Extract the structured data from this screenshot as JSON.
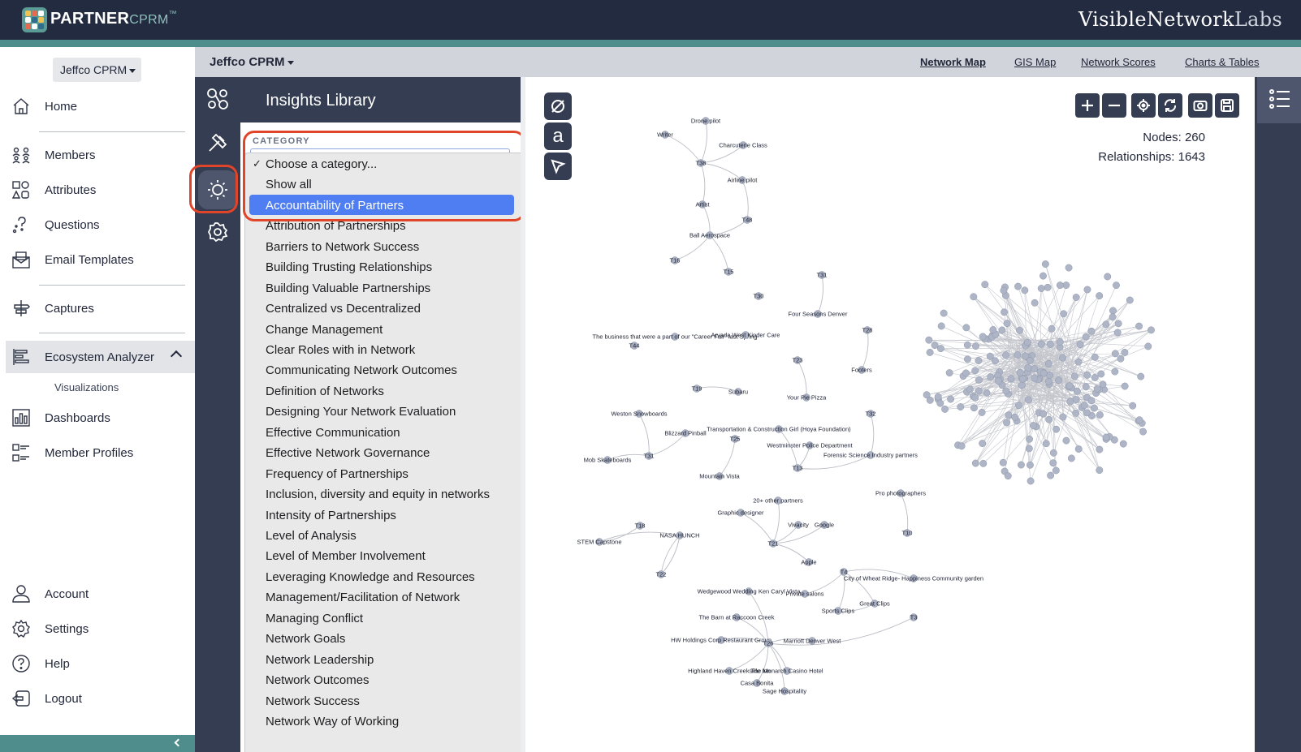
{
  "header": {
    "logo_main": "PARTNER",
    "logo_sub": "CPRM",
    "logo_tm": "™",
    "brand_main": "VisibleNetwork",
    "brand_sub": "Labs"
  },
  "sidebar": {
    "org": "Jeffco CPRM",
    "items": {
      "home": "Home",
      "members": "Members",
      "attributes": "Attributes",
      "questions": "Questions",
      "email_templates": "Email Templates",
      "captures": "Captures",
      "ecosystem": "Ecosystem Analyzer",
      "visualizations": "Visualizations",
      "dashboards": "Dashboards",
      "member_profiles": "Member Profiles",
      "account": "Account",
      "settings": "Settings",
      "help": "Help",
      "logout": "Logout"
    }
  },
  "subheader": {
    "project": "Jeffco CPRM",
    "tabs": [
      "Network Map",
      "GIS Map",
      "Network Scores",
      "Charts & Tables"
    ]
  },
  "panel": {
    "title": "Insights Library",
    "category_label": "CATEGORY",
    "options": [
      "Choose a category...",
      "Show all",
      "Accountability of Partners",
      "Attribution of Partnerships",
      "Barriers to Network Success",
      "Building Trusting Relationships",
      "Building Valuable Partnerships",
      "Centralized vs Decentralized",
      "Change Management",
      "Clear Roles with in Network",
      "Communicating Network Outcomes",
      "Definition of Networks",
      "Designing Your Network Evaluation",
      "Effective Communication",
      "Effective Network Governance",
      "Frequency of Partnerships",
      "Inclusion, diversity and equity in networks",
      "Intensity of Partnerships",
      "Level of Analysis",
      "Level of Member Involvement",
      "Leveraging Knowledge and Resources",
      "Management/Facilitation of Network",
      "Managing Conflict",
      "Network Goals",
      "Network Leadership",
      "Network Outcomes",
      "Network Success",
      "Network Way of Working"
    ],
    "checked_option": "Choose a category...",
    "highlighted_option": "Accountability of Partners"
  },
  "network": {
    "tools": [
      "none-icon",
      "label-a-icon",
      "pointer-icon"
    ],
    "tool_letter": "a",
    "nodes_label": "Nodes: 260",
    "relationships_label": "Relationships: 1643",
    "nodes": 260,
    "relationships": 1643,
    "labels": [
      "Drone pilot",
      "Writer",
      "Charcuterie Class",
      "T38",
      "Airline pilot",
      "Artist",
      "T48",
      "Ball Aerospace",
      "T16",
      "T15",
      "T30",
      "T31",
      "Four Seasons Denver",
      "The business that were a part of our \"Career Fair\" last Spring",
      "Arvada West Kinder Care",
      "T44",
      "T28",
      "T23",
      "Footers",
      "T19",
      "Subaru",
      "Your Pie Pizza",
      "Weston Snowboards",
      "T32",
      "Blizzard Pinball",
      "T25",
      "Transportation & Construction Girl (Hoya Foundation)",
      "Westminster Police Department",
      "Forensic Science Industry partners",
      "Mob Skateboards",
      "T31",
      "Mountain Vista",
      "T13",
      "20+ other partners",
      "Pro photographers",
      "Graphic designer",
      "Vivacity",
      "Google",
      "T18",
      "STEM Capstone",
      "NASA HUNCH",
      "T21",
      "Apple",
      "T10",
      "T22",
      "T4",
      "City of Wheat Ridge- Happiness Community garden",
      "Wedgewood Wedding Ken Caryl Vista",
      "Private salons",
      "Great Clips",
      "Sports Clips",
      "The Barn at Raccoon Creek",
      "T3",
      "HW Holdings Corp Restaurant Group",
      "T26",
      "Marriott Denver West",
      "Highland Haven Creekside Inn",
      "The Monarch Casino Hotel",
      "Casa Bonita",
      "Sage Hospitality"
    ]
  },
  "colors": {
    "topbar": "#232b40",
    "accent": "#4f8d8c",
    "rail": "#353d52",
    "highlight": "#4f7ef2",
    "callout": "#e0452a"
  }
}
